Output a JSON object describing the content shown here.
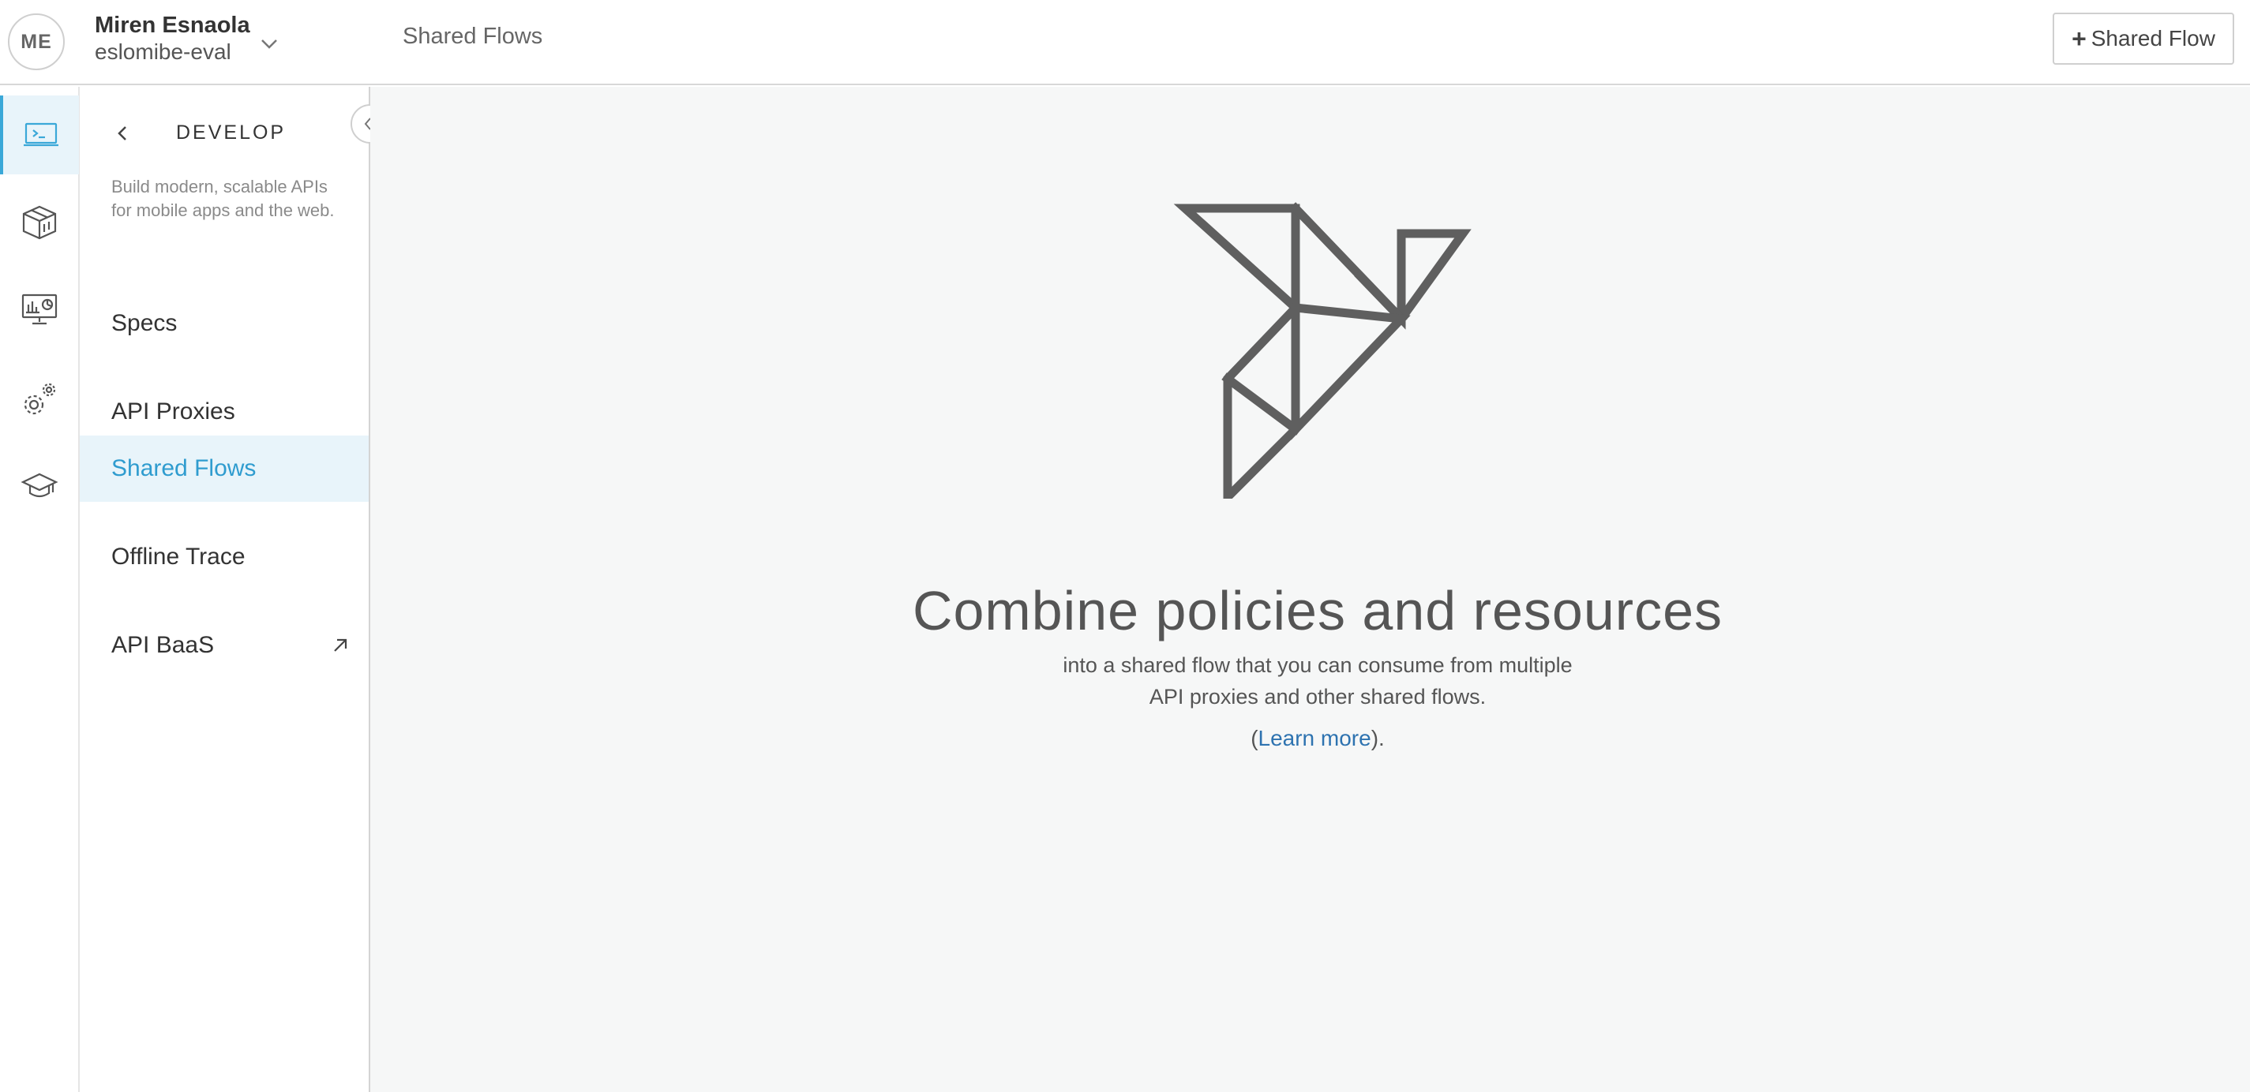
{
  "header": {
    "avatar_initials": "ME",
    "user_name": "Miren Esnaola",
    "org_name": "eslomibe-eval",
    "breadcrumb": "Shared Flows",
    "add_button_label": "Shared Flow",
    "add_button_icon": "plus-icon"
  },
  "rail": {
    "items": [
      {
        "icon": "develop-laptop-icon",
        "active": true
      },
      {
        "icon": "publish-box-icon",
        "active": false
      },
      {
        "icon": "analyze-monitor-icon",
        "active": false
      },
      {
        "icon": "admin-gears-icon",
        "active": false
      },
      {
        "icon": "learn-graduation-cap-icon",
        "active": false
      }
    ]
  },
  "panel": {
    "title": "DEVELOP",
    "description": "Build modern, scalable APIs for mobile apps and the web.",
    "items": [
      {
        "label": "Specs",
        "active": false
      },
      {
        "label": "API Proxies",
        "active": false
      },
      {
        "label": "Shared Flows",
        "active": true
      },
      {
        "label": "Offline Trace",
        "active": false
      },
      {
        "label": "API BaaS",
        "active": false,
        "external": true
      }
    ]
  },
  "main": {
    "illustration": "origami-bird-icon",
    "title": "Combine policies and resources",
    "subtitle_line1": "into a shared flow that you can consume from multiple",
    "subtitle_line2": "API proxies and other shared flows.",
    "learn_prefix": "(",
    "learn_link": "Learn more",
    "learn_suffix": ")."
  },
  "colors": {
    "accent": "#3aa8d8",
    "active_bg": "#e8f4fa",
    "link": "#2e73b0",
    "main_bg": "#f6f7f7",
    "illustration": "#5f5f5f"
  }
}
